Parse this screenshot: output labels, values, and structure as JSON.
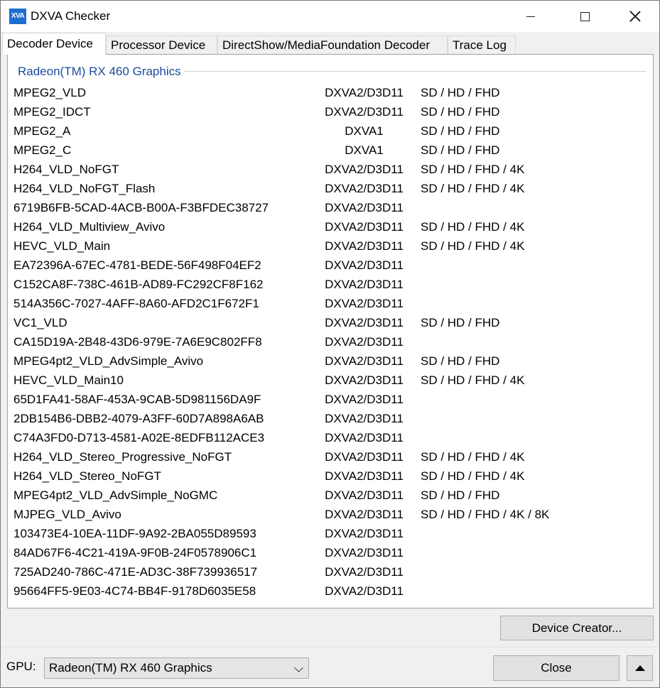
{
  "window": {
    "title": "DXVA Checker",
    "icon_text": "XVA",
    "icon": "dxva-app-icon"
  },
  "tabs": [
    {
      "label": "Decoder Device",
      "active": true
    },
    {
      "label": "Processor Device"
    },
    {
      "label": "DirectShow/MediaFoundation Decoder"
    },
    {
      "label": "Trace Log"
    }
  ],
  "group": {
    "title": "Radeon(TM) RX 460 Graphics"
  },
  "decoders": [
    {
      "name": "MPEG2_VLD",
      "api": "DXVA2/D3D11",
      "res": "SD / HD / FHD"
    },
    {
      "name": "MPEG2_IDCT",
      "api": "DXVA2/D3D11",
      "res": "SD / HD / FHD"
    },
    {
      "name": "MPEG2_A",
      "api": "DXVA1",
      "res": "SD / HD / FHD"
    },
    {
      "name": "MPEG2_C",
      "api": "DXVA1",
      "res": "SD / HD / FHD"
    },
    {
      "name": "H264_VLD_NoFGT",
      "api": "DXVA2/D3D11",
      "res": "SD / HD / FHD / 4K"
    },
    {
      "name": "H264_VLD_NoFGT_Flash",
      "api": "DXVA2/D3D11",
      "res": "SD / HD / FHD / 4K"
    },
    {
      "name": "6719B6FB-5CAD-4ACB-B00A-F3BFDEC38727",
      "api": "DXVA2/D3D11",
      "res": ""
    },
    {
      "name": "H264_VLD_Multiview_Avivo",
      "api": "DXVA2/D3D11",
      "res": "SD / HD / FHD / 4K"
    },
    {
      "name": "HEVC_VLD_Main",
      "api": "DXVA2/D3D11",
      "res": "SD / HD / FHD / 4K"
    },
    {
      "name": "EA72396A-67EC-4781-BEDE-56F498F04EF2",
      "api": "DXVA2/D3D11",
      "res": ""
    },
    {
      "name": "C152CA8F-738C-461B-AD89-FC292CF8F162",
      "api": "DXVA2/D3D11",
      "res": ""
    },
    {
      "name": "514A356C-7027-4AFF-8A60-AFD2C1F672F1",
      "api": "DXVA2/D3D11",
      "res": ""
    },
    {
      "name": "VC1_VLD",
      "api": "DXVA2/D3D11",
      "res": "SD / HD / FHD"
    },
    {
      "name": "CA15D19A-2B48-43D6-979E-7A6E9C802FF8",
      "api": "DXVA2/D3D11",
      "res": ""
    },
    {
      "name": "MPEG4pt2_VLD_AdvSimple_Avivo",
      "api": "DXVA2/D3D11",
      "res": "SD / HD / FHD"
    },
    {
      "name": "HEVC_VLD_Main10",
      "api": "DXVA2/D3D11",
      "res": "SD / HD / FHD / 4K"
    },
    {
      "name": "65D1FA41-58AF-453A-9CAB-5D981156DA9F",
      "api": "DXVA2/D3D11",
      "res": ""
    },
    {
      "name": "2DB154B6-DBB2-4079-A3FF-60D7A898A6AB",
      "api": "DXVA2/D3D11",
      "res": ""
    },
    {
      "name": "C74A3FD0-D713-4581-A02E-8EDFB112ACE3",
      "api": "DXVA2/D3D11",
      "res": ""
    },
    {
      "name": "H264_VLD_Stereo_Progressive_NoFGT",
      "api": "DXVA2/D3D11",
      "res": "SD / HD / FHD / 4K"
    },
    {
      "name": "H264_VLD_Stereo_NoFGT",
      "api": "DXVA2/D3D11",
      "res": "SD / HD / FHD / 4K"
    },
    {
      "name": "MPEG4pt2_VLD_AdvSimple_NoGMC",
      "api": "DXVA2/D3D11",
      "res": "SD / HD / FHD"
    },
    {
      "name": "MJPEG_VLD_Avivo",
      "api": "DXVA2/D3D11",
      "res": "SD / HD / FHD / 4K / 8K"
    },
    {
      "name": "103473E4-10EA-11DF-9A92-2BA055D89593",
      "api": "DXVA2/D3D11",
      "res": ""
    },
    {
      "name": "84AD67F6-4C21-419A-9F0B-24F0578906C1",
      "api": "DXVA2/D3D11",
      "res": ""
    },
    {
      "name": "725AD240-786C-471E-AD3C-38F739936517",
      "api": "DXVA2/D3D11",
      "res": ""
    },
    {
      "name": "95664FF5-9E03-4C74-BB4F-9178D6035E58",
      "api": "DXVA2/D3D11",
      "res": ""
    }
  ],
  "buttons": {
    "device_creator": "Device Creator...",
    "close": "Close"
  },
  "footer": {
    "gpu_label": "GPU:",
    "gpu_selected": "Radeon(TM) RX 460 Graphics"
  },
  "colors": {
    "group_title": "#1a4ca0",
    "app_icon": "#1e6fd0"
  }
}
